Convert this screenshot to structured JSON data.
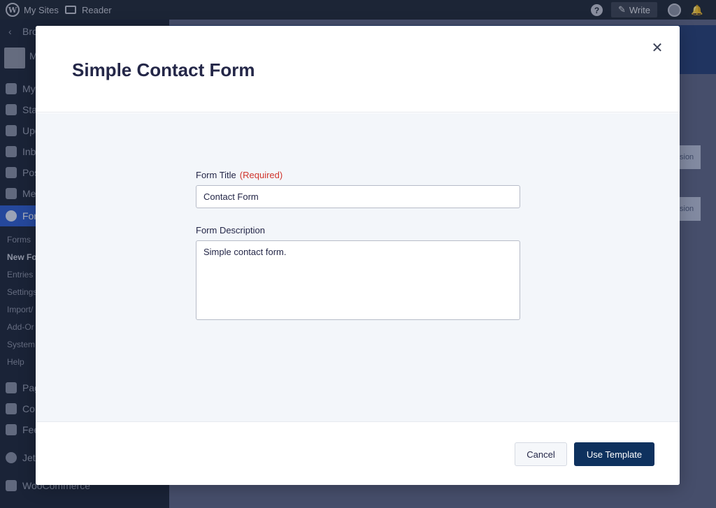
{
  "admin_bar": {
    "my_sites": "My Sites",
    "reader": "Reader",
    "write": "Write"
  },
  "sidebar": {
    "back": "Bro",
    "site_initial": "M",
    "items": [
      {
        "label": "My",
        "icon": "home-icon"
      },
      {
        "label": "Stat",
        "icon": "stats-icon"
      },
      {
        "label": "Upg",
        "icon": "cart-icon"
      },
      {
        "label": "Inb",
        "icon": "mail-icon"
      },
      {
        "label": "Pos",
        "icon": "pin-icon"
      },
      {
        "label": "Me",
        "icon": "media-icon"
      },
      {
        "label": "For",
        "icon": "forms-icon"
      }
    ],
    "sub_items": [
      "Forms",
      "New Fo",
      "Entries",
      "Settings",
      "Import/",
      "Add-Or",
      "System",
      "Help"
    ],
    "bottom_items": [
      {
        "label": "Pag",
        "icon": "pages-icon"
      },
      {
        "label": "Co",
        "icon": "comments-icon"
      },
      {
        "label": "Fee",
        "icon": "feedback-icon"
      },
      {
        "label": "Jetp",
        "icon": "jetpack-icon"
      },
      {
        "label": "WooCommerce",
        "icon": "woocommerce-icon"
      }
    ]
  },
  "background": {
    "box1": "sion",
    "box2": "sion"
  },
  "modal": {
    "title": "Simple Contact Form",
    "close_icon": "close-icon",
    "form_title_label": "Form Title",
    "required_label": "(Required)",
    "form_title_value": "Contact Form",
    "form_description_label": "Form Description",
    "form_description_value": "Simple contact form.",
    "cancel_label": "Cancel",
    "use_template_label": "Use Template"
  },
  "colors": {
    "primary_button": "#0e315e",
    "required_text": "#d0352c",
    "body_background": "#f3f6fa"
  }
}
